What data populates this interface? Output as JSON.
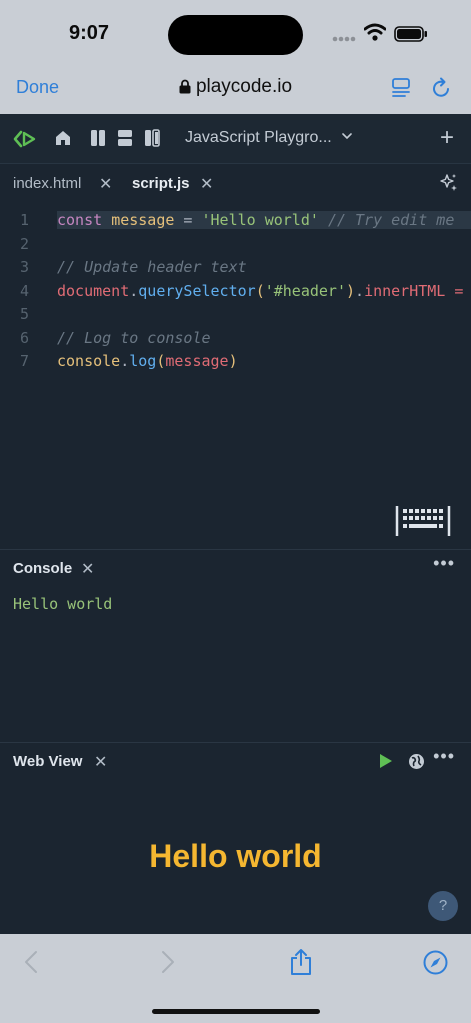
{
  "status_bar": {
    "time": "9:07"
  },
  "browser": {
    "done_label": "Done",
    "url": "playcode.io"
  },
  "toolbar": {
    "project_name": "JavaScript Playgro...",
    "add_label": "+"
  },
  "tabs": [
    {
      "label": "index.html",
      "active": false
    },
    {
      "label": "script.js",
      "active": true
    }
  ],
  "editor": {
    "line_numbers": [
      "1",
      "2",
      "3",
      "4",
      "5",
      "6",
      "7"
    ],
    "lines": [
      [
        {
          "t": "const",
          "c": "kw"
        },
        {
          "t": " ",
          "c": "pun"
        },
        {
          "t": "message",
          "c": "var"
        },
        {
          "t": " = ",
          "c": "pun"
        },
        {
          "t": "'Hello world'",
          "c": "str"
        },
        {
          "t": " ",
          "c": "pun"
        },
        {
          "t": "// Try edit me",
          "c": "cm"
        }
      ],
      [],
      [
        {
          "t": "// Update header text",
          "c": "cm"
        }
      ],
      [
        {
          "t": "document",
          "c": "prop"
        },
        {
          "t": ".",
          "c": "pun"
        },
        {
          "t": "querySelector",
          "c": "fn"
        },
        {
          "t": "(",
          "c": "var"
        },
        {
          "t": "'#header'",
          "c": "str"
        },
        {
          "t": ")",
          "c": "var"
        },
        {
          "t": ".",
          "c": "pun"
        },
        {
          "t": "innerHTML = message",
          "c": "prop"
        }
      ],
      [],
      [
        {
          "t": "// Log to console",
          "c": "cm"
        }
      ],
      [
        {
          "t": "console",
          "c": "var"
        },
        {
          "t": ".",
          "c": "pun"
        },
        {
          "t": "log",
          "c": "fn"
        },
        {
          "t": "(",
          "c": "var"
        },
        {
          "t": "message",
          "c": "prop"
        },
        {
          "t": ")",
          "c": "var"
        }
      ]
    ]
  },
  "console": {
    "title": "Console",
    "output": "Hello world",
    "more_label": "•••"
  },
  "webview": {
    "title": "Web View",
    "heading": "Hello world",
    "help_label": "?",
    "more_label": "•••"
  },
  "colors": {
    "accent": "#2f7fd8",
    "heading": "#f5b731",
    "console_text": "#98c379",
    "logo_green": "#5fbf55"
  }
}
